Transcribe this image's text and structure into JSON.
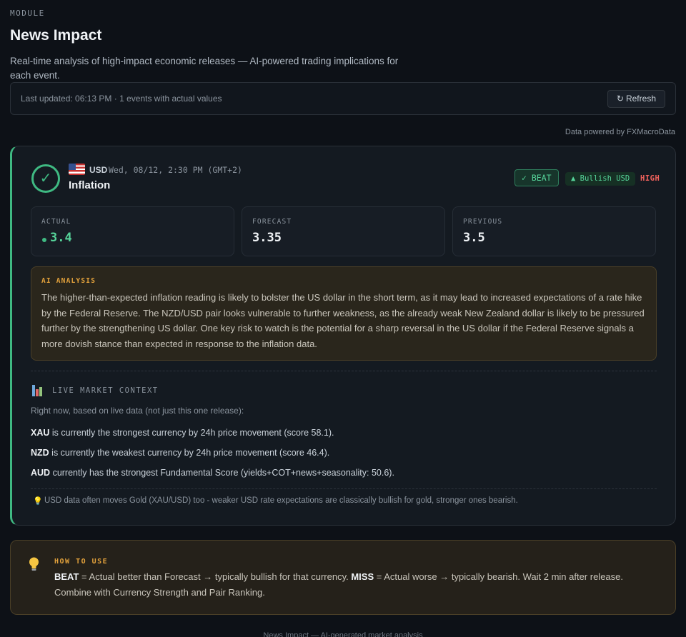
{
  "header": {
    "module_label": "MODULE",
    "title": "News Impact",
    "description": "Real-time analysis of high-impact economic releases — AI-powered trading implications for each event."
  },
  "update_bar": {
    "text": "Last updated: 06:13 PM · 1 events with actual values",
    "refresh_label": "Refresh",
    "refresh_icon": "↻"
  },
  "powered_by": "Data powered by FXMacroData",
  "event": {
    "status_icon": "check-circle-icon",
    "status_glyph": "✓",
    "flag": "us-flag-icon",
    "currency": "USD",
    "datetime": "Wed, 08/12, 2:30 PM (GMT+2)",
    "name": "Inflation",
    "badge_beat": "✓ BEAT",
    "badge_bias": "▲ Bullish USD",
    "badge_impact": "HIGH",
    "stats": [
      {
        "label": "ACTUAL",
        "value": "3.4"
      },
      {
        "label": "FORECAST",
        "value": "3.35"
      },
      {
        "label": "PREVIOUS",
        "value": "3.5"
      }
    ],
    "ai_label": "AI ANALYSIS",
    "ai_text": "The higher-than-expected inflation reading is likely to bolster the US dollar in the short term, as it may lead to increased expectations of a rate hike by the Federal Reserve. The NZD/USD pair looks vulnerable to further weakness, as the already weak New Zealand dollar is likely to be pressured further by the strengthening US dollar. One key risk to watch is the potential for a sharp reversal in the US dollar if the Federal Reserve signals a more dovish stance than expected in response to the inflation data."
  },
  "context": {
    "icon": "bar-chart-icon",
    "label": "LIVE MARKET CONTEXT",
    "subtitle": "Right now, based on live data (not just this one release):",
    "lines": [
      {
        "code": "XAU",
        "text": " is currently the strongest currency by 24h price movement (score 58.1)."
      },
      {
        "code": "NZD",
        "text": " is currently the weakest currency by 24h price movement (score 46.4)."
      },
      {
        "code": "AUD",
        "text": " currently has the strongest Fundamental Score (yields+COT+news+seasonality: 50.6)."
      }
    ],
    "tip_icon": "lightbulb-icon",
    "tip_glyph": "💡",
    "tip": "USD data often moves Gold (XAU/USD) too - weaker USD rate expectations are classically bullish for gold, stronger ones bearish."
  },
  "how_to": {
    "icon": "lightbulb-icon",
    "label": "HOW TO USE",
    "beat_word": "BEAT",
    "beat_text": " = Actual better than Forecast → typically bullish for that currency. ",
    "miss_word": "MISS",
    "miss_text": " = Actual worse → typically bearish. Wait 2 min after release. Combine with Currency Strength and Pair Ranking."
  },
  "footer": "News Impact — AI-generated market analysis",
  "colors": {
    "background": "#0d1117",
    "accent_green": "#3fb982",
    "accent_amber": "#e3a23c",
    "impact_red": "#f0615c"
  }
}
